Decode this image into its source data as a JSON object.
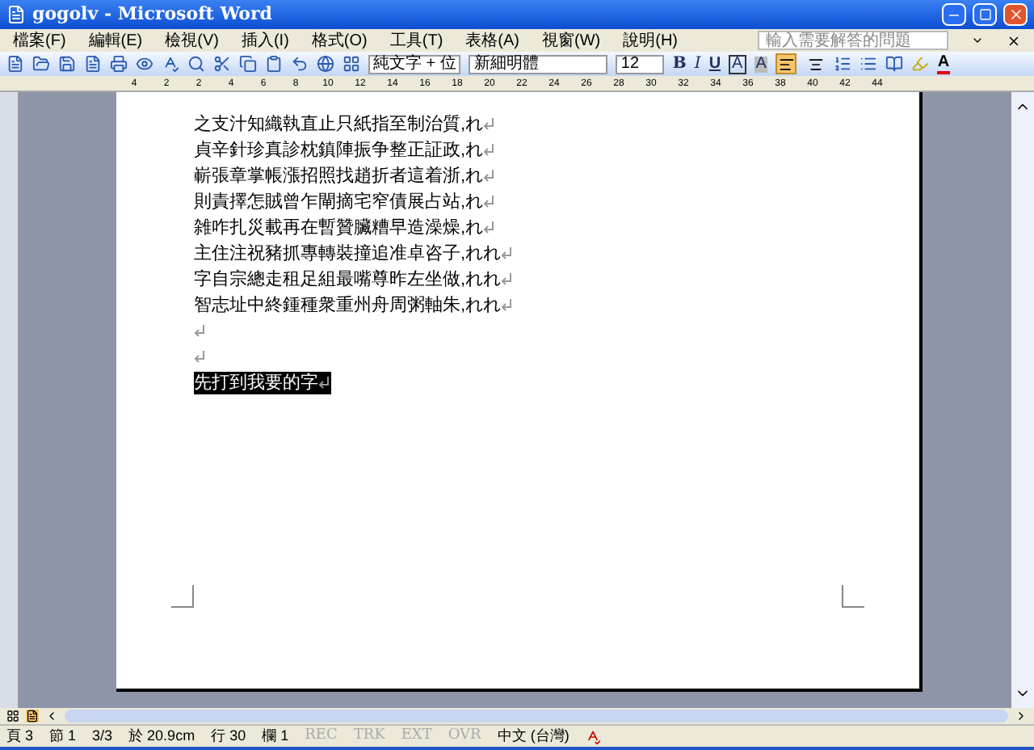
{
  "window": {
    "title": "gogolv - Microsoft Word"
  },
  "menu": [
    "檔案(F)",
    "編輯(E)",
    "檢視(V)",
    "插入(I)",
    "格式(O)",
    "工具(T)",
    "表格(A)",
    "視窗(W)",
    "說明(H)"
  ],
  "help_box": {
    "placeholder": "輸入需要解答的問題"
  },
  "toolbar": {
    "style": "純文字 + 位",
    "font": "新細明體",
    "size": "12",
    "format_buttons": [
      {
        "label": "B",
        "kind": "bold"
      },
      {
        "label": "I",
        "kind": "italic"
      },
      {
        "label": "U",
        "kind": "underline"
      },
      {
        "label": "A",
        "kind": "border"
      },
      {
        "label": "A",
        "kind": "shade"
      }
    ],
    "font_color": {
      "label": "A"
    },
    "alignment": [
      {
        "kind": "left",
        "selected": true
      },
      {
        "kind": "center",
        "selected": false
      }
    ]
  },
  "ruler": [
    "4",
    "2",
    "2",
    "4",
    "6",
    "8",
    "10",
    "12",
    "14",
    "16",
    "18",
    "20",
    "22",
    "24",
    "26",
    "28",
    "30",
    "32",
    "34",
    "36",
    "38",
    "40",
    "42",
    "44"
  ],
  "document": {
    "paragraphs": [
      {
        "text": "之支汁知織執直止只紙指至制治質,れ",
        "selected": false
      },
      {
        "text": "貞辛針珍真診枕鎮陣振争整正証政,れ",
        "selected": false
      },
      {
        "text": "嶄張章掌帳漲招照找趙折者這着浙,れ",
        "selected": false
      },
      {
        "text": "則責擇怎賊曾乍閘摘宅窄債展占站,れ",
        "selected": false
      },
      {
        "text": "雑咋扎災載再在暫贊臟糟早造澡燥,れ",
        "selected": false
      },
      {
        "text": "主住注祝豬抓專轉裝撞追准卓咨子,れれ",
        "selected": false
      },
      {
        "text": "字自宗總走租足組最嘴尊昨左坐做,れれ",
        "selected": false
      },
      {
        "text": "智志址中終鍾種衆重州舟周粥軸朱,れれ",
        "selected": false
      },
      {
        "selected": false
      },
      {
        "selected": false
      },
      {
        "text": "先打到我要的字",
        "selected": true
      }
    ]
  },
  "status_bar": {
    "fields": [
      "頁 3",
      "節 1",
      "3/3",
      "於 20.9cm",
      "行 30",
      "欄 1"
    ],
    "modes": [
      {
        "label": "REC",
        "on": false
      },
      {
        "label": "TRK",
        "on": false
      },
      {
        "label": "EXT",
        "on": false
      },
      {
        "label": "OVR",
        "on": false
      }
    ],
    "language": "中文 (台灣)"
  }
}
